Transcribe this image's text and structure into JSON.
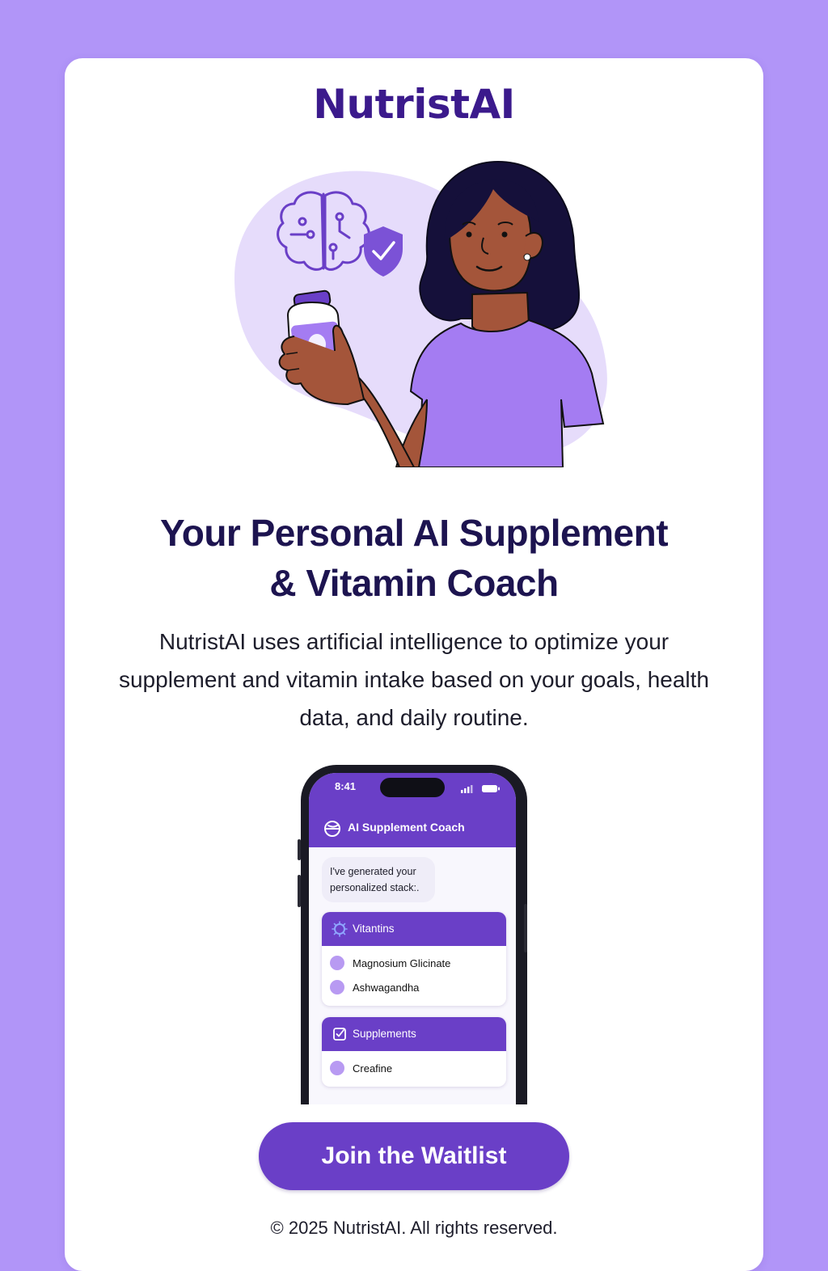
{
  "brand": {
    "name": "NutristAI",
    "accent": "#6a3fc7",
    "page_background": "#b195f8"
  },
  "hero": {
    "headline_line1": "Your Personal AI Supplement",
    "headline_line2": "& Vitamin Coach",
    "description": "NutristAI uses artificial intelligence to optimize your supplement and vitamin intake based on your goals, health data, and daily routine."
  },
  "phone": {
    "time": "8:41",
    "app_title": "AI Supplement Coach",
    "message": "I've generated your personalized stack:.",
    "sections": [
      {
        "title": "Vitantins",
        "icon": "sun-icon",
        "items": [
          "Magnosium Glicinate",
          "Ashwagandha"
        ]
      },
      {
        "title": "Supplements",
        "icon": "checkbox-icon",
        "items": [
          "Creafine"
        ]
      }
    ]
  },
  "cta": {
    "label": "Join the Waitlist"
  },
  "footer": {
    "text": "© 2025 NutristAI. All rights reserved."
  }
}
